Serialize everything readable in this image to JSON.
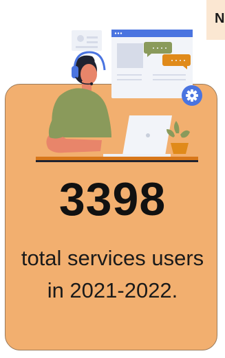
{
  "corner_badge": {
    "text": "N"
  },
  "stat": {
    "value": "3398",
    "caption": "total services users in 2021-2022."
  },
  "colors": {
    "card_background": "#f2af6f",
    "accent_blue": "#4a74e0",
    "shirt_green": "#8a9a5b",
    "chat_green": "#8a9a5b",
    "chat_orange": "#e08a1a"
  },
  "icons": [
    "headset-icon",
    "gear-icon",
    "chat-bubble-icon",
    "laptop-icon",
    "plant-icon",
    "contact-card-icon",
    "browser-window-icon"
  ]
}
